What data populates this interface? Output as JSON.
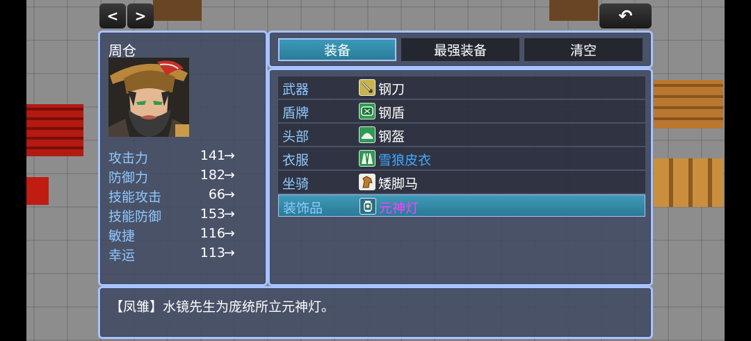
{
  "actor": {
    "name": "周仓"
  },
  "params": [
    {
      "label": "攻击力",
      "value": "141",
      "arrow": "→"
    },
    {
      "label": "防御力",
      "value": "182",
      "arrow": "→"
    },
    {
      "label": "技能攻击",
      "value": "66",
      "arrow": "→"
    },
    {
      "label": "技能防御",
      "value": "153",
      "arrow": "→"
    },
    {
      "label": "敏捷",
      "value": "116",
      "arrow": "→"
    },
    {
      "label": "幸运",
      "value": "113",
      "arrow": "→"
    }
  ],
  "commands": [
    {
      "label": "装备",
      "selected": true
    },
    {
      "label": "最强装备",
      "selected": false
    },
    {
      "label": "清空",
      "selected": false
    }
  ],
  "slots": [
    {
      "slot": "武器",
      "item": "钢刀",
      "icon": "sword-icon",
      "item_color": "#ffffff"
    },
    {
      "slot": "盾牌",
      "item": "钢盾",
      "icon": "shield-icon",
      "item_color": "#ffffff"
    },
    {
      "slot": "头部",
      "item": "钢盔",
      "icon": "helmet-icon",
      "item_color": "#ffffff"
    },
    {
      "slot": "衣服",
      "item": "雪狼皮衣",
      "icon": "fur-coat-icon",
      "item_color": "#40a8ff"
    },
    {
      "slot": "坐骑",
      "item": "矮脚马",
      "icon": "horse-icon",
      "item_color": "#ffffff"
    },
    {
      "slot": "装饰品",
      "item": "元神灯",
      "icon": "lantern-icon",
      "item_color": "#ff3cff"
    }
  ],
  "help": {
    "text": "【凤雏】水镜先生为庞统所立元神灯。"
  },
  "nav": {
    "prev": "<",
    "next": ">",
    "back": "↶"
  },
  "colors": {
    "window_border": "#a9c3ff",
    "system_label": "#8fc8ff",
    "selection": "#2a7d99"
  }
}
